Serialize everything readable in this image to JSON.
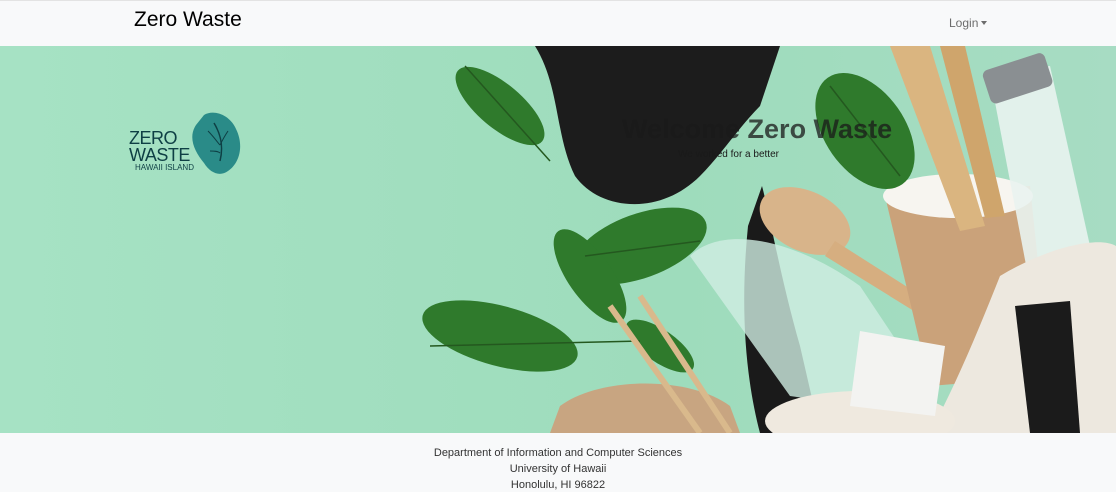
{
  "navbar": {
    "brand": "Zero Waste",
    "login_label": "Login"
  },
  "hero": {
    "logo": {
      "line1": "ZERO",
      "line2": "WASTE",
      "line3": "HAWAII ISLAND"
    },
    "title": "Welcome Zero Waste",
    "subtitle": "We worked for a better"
  },
  "footer": {
    "line1": "Department of Information and Computer Sciences",
    "line2": "University of Hawaii",
    "line3": "Honolulu, HI 96822"
  }
}
